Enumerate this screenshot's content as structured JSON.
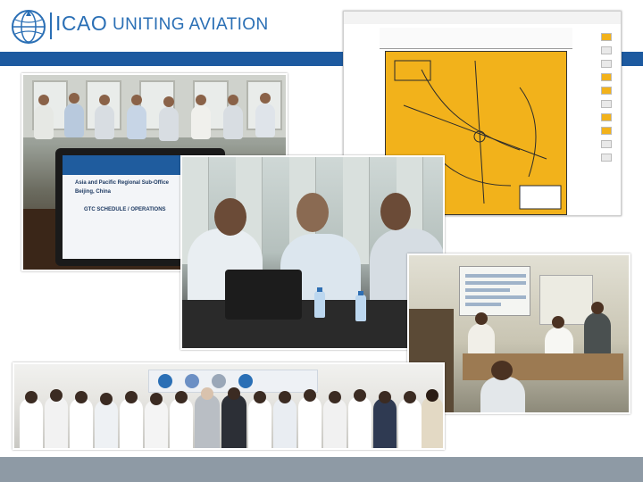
{
  "header": {
    "org": "ICAO",
    "tagline": "UNITING AVIATION"
  },
  "colors": {
    "brand_blue": "#2a6fb5",
    "bar_blue": "#1d5aa0",
    "footer_gray": "#8e9aa5",
    "chart_yellow": "#f2b21b"
  },
  "icons": {
    "logo": "icao-globe-logo-icon"
  },
  "photos": {
    "meeting_room": {
      "laptop_line1": "Asia and Pacific Regional Sub-Office",
      "laptop_line2": "Beijing, China",
      "laptop_line3": "GTC SCHEDULE / OPERATIONS"
    }
  }
}
